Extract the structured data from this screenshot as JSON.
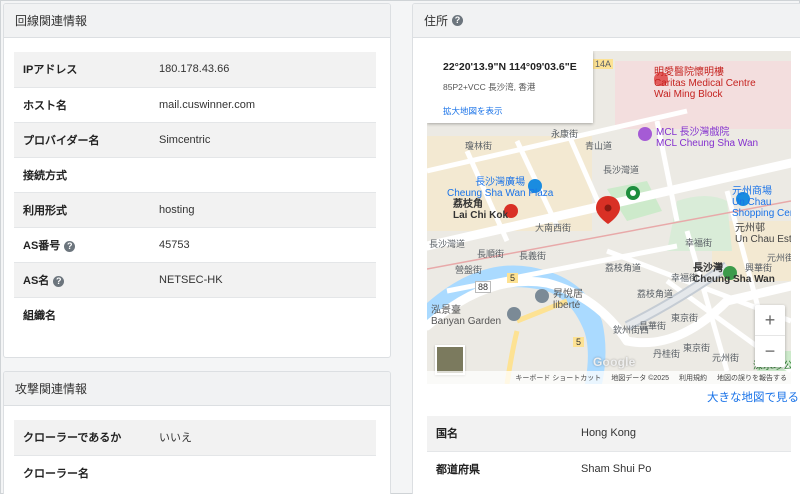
{
  "network_panel": {
    "title": "回線関連情報",
    "rows": [
      {
        "key": "IPアドレス",
        "value": "180.178.43.66"
      },
      {
        "key": "ホスト名",
        "value": "mail.cuswinner.com"
      },
      {
        "key": "プロバイダー名",
        "value": "Simcentric"
      },
      {
        "key": "接続方式",
        "value": ""
      },
      {
        "key": "利用形式",
        "value": "hosting"
      },
      {
        "key": "AS番号",
        "value": "45753"
      },
      {
        "key": "AS名",
        "value": "NETSEC-HK"
      },
      {
        "key": "組織名",
        "value": ""
      }
    ]
  },
  "attack_panel": {
    "title": "攻撃関連情報",
    "rows": [
      {
        "key": "クローラーであるか",
        "value": "いいえ"
      },
      {
        "key": "クローラー名",
        "value": ""
      }
    ]
  },
  "address_panel": {
    "title": "住所",
    "map": {
      "coordinates": "22°20'13.9\"N 114°09'03.6\"E",
      "plus_code": "85P2+VCC 長沙湾, 香港",
      "enlarge_link": "拡大地図を表示",
      "zoom_in": "+",
      "zoom_out": "−",
      "google": "Google",
      "footer": {
        "shortcuts": "キーボード ショートカット",
        "map_data": "地図データ ©2025",
        "terms": "利用規約",
        "report": "地図の誤りを報告する"
      },
      "labels": {
        "route": "14A",
        "hospital_ja": "明愛醫院懷明樓",
        "hospital_en1": "Caritas Medical Centre",
        "hospital_en2": "Wai Ming Block",
        "mall_ja": "MCL 長沙灣戲院",
        "mall_en": "MCL Cheung Sha Wan",
        "plaza_ja": "長沙灣廣場",
        "plaza_en": "Cheung Sha Wan Plaza",
        "station_ja": "荔枝角",
        "station_en": "Lai Chi Kok",
        "unchau_ja": "元州商場",
        "unchau_en1": "Un Chau",
        "unchau_en2": "Shopping Centre",
        "unchau_est_ja": "元州邨",
        "unchau_est_en": "Un Chau Estate",
        "csw_ja": "長沙灣",
        "csw_en": "Cheung Sha Wan",
        "liberte_ja": "昇悅居",
        "liberte_en": "liberté",
        "banyan_ja": "泓景臺",
        "banyan_en": "Banyan Garden",
        "park": "深水埗公園",
        "rd1": "瓊林街",
        "rd2": "永康街",
        "rd3": "青山道",
        "rd4": "長沙灣道",
        "rd5": "大南西街",
        "rd6": "長沙灣道",
        "rd7": "長順街",
        "rd8": "長義街",
        "rd9": "荔枝角道",
        "rd10": "幸福街",
        "rd11": "營盤街",
        "rd12": "荔枝角道",
        "rd13": "東京街",
        "rd14": "昌華街",
        "rd15": "欽州街西",
        "rd16": "丹桂街",
        "rd17": "元州街",
        "rd18": "幸福街",
        "rd19": "東京街",
        "rd20": "元州街",
        "rd21": "興華街",
        "badge5a": "5",
        "badge5b": "5",
        "badge88": "88"
      }
    },
    "bigger_map_link": "大きな地図で見る",
    "rows": [
      {
        "key": "国名",
        "value": "Hong Kong"
      },
      {
        "key": "都道府県",
        "value": "Sham Shui Po"
      }
    ]
  },
  "colors": {
    "link": "#1a73e8",
    "pin": "#d93025",
    "water": "#aadaff",
    "park": "#cdeacb"
  }
}
